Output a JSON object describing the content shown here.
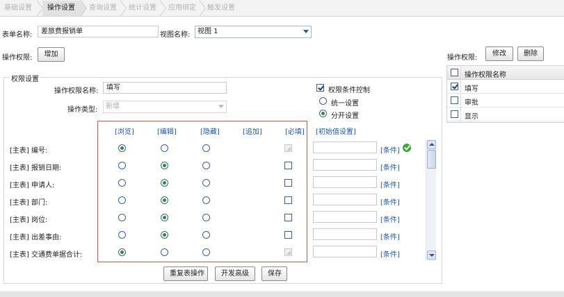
{
  "steps": [
    {
      "label": "基础设置"
    },
    {
      "label": "操作设置"
    },
    {
      "label": "查询设置"
    },
    {
      "label": "统计设置"
    },
    {
      "label": "应用绑定"
    },
    {
      "label": "触发设置"
    }
  ],
  "form": {
    "table_name_label": "表单名称:",
    "table_name_value": "差旅费报销单",
    "view_name_label": "视图名称:",
    "view_name_value": "视图 1"
  },
  "permissions": {
    "label": "操作权限:",
    "add_button": "增加"
  },
  "fieldset": {
    "legend": "权限设置",
    "op_name_label": "操作权限名称:",
    "op_name_value": "填写",
    "op_type_label": "操作类型:",
    "op_type_value": "新增",
    "condition_control_label": "权限条件控制",
    "condition_control_checked": true,
    "unified_label": "统一设置",
    "separate_label": "分开设置",
    "separate_selected": true
  },
  "columns": {
    "browse": "[浏览]",
    "edit": "[编辑]",
    "hide": "[隐藏]",
    "append": "[追加]",
    "required": "[必填]",
    "initial": "[初始值设置]"
  },
  "rows": [
    {
      "label": "[主表] 编号:",
      "selected": "browse",
      "required": false,
      "required_disabled": true,
      "condition": "[条件]",
      "condition_ok": true
    },
    {
      "label": "[主表] 报销日期:",
      "selected": "edit",
      "required": false,
      "required_disabled": false,
      "condition": "[条件]",
      "condition_ok": false
    },
    {
      "label": "[主表] 申请人:",
      "selected": "edit",
      "required": false,
      "required_disabled": false,
      "condition": "[条件]",
      "condition_ok": false
    },
    {
      "label": "[主表] 部门:",
      "selected": "edit",
      "required": false,
      "required_disabled": false,
      "condition": "[条件]",
      "condition_ok": false
    },
    {
      "label": "[主表] 岗位:",
      "selected": "edit",
      "required": false,
      "required_disabled": false,
      "condition": "[条件]",
      "condition_ok": false
    },
    {
      "label": "[主表] 出差事由:",
      "selected": "edit",
      "required": false,
      "required_disabled": false,
      "condition": "[条件]",
      "condition_ok": false
    },
    {
      "label": "[主表] 交通费单据合计:",
      "selected": "browse",
      "required": false,
      "required_disabled": true,
      "condition": "[条件]",
      "condition_ok": false
    }
  ],
  "actions": {
    "repeat_button": "重复表操作",
    "advanced_button": "开发高级",
    "save_button": "保存"
  },
  "right_panel": {
    "label": "操作权限:",
    "modify_button": "修改",
    "delete_button": "删除",
    "header": "操作权限名称",
    "items": [
      {
        "label": "填写",
        "checked": true
      },
      {
        "label": "审批",
        "checked": false
      },
      {
        "label": "显示",
        "checked": false
      }
    ]
  },
  "colors": {
    "accent_link": "#1f56a8",
    "highlight_border": "#e25050",
    "ok_green": "#3ba53a"
  }
}
